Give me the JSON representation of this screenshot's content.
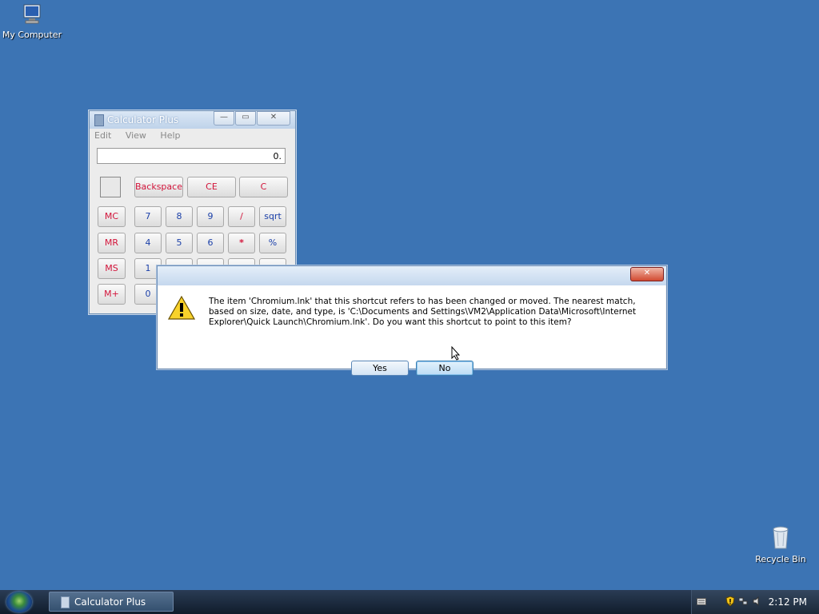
{
  "desktop": {
    "my_computer_label": "My Computer",
    "recycle_bin_label": "Recycle Bin"
  },
  "calculator": {
    "title": "Calculator Plus",
    "menu": [
      "Edit",
      "View",
      "Help"
    ],
    "display_value": "0.",
    "top_buttons": [
      "Backspace",
      "CE",
      "C"
    ],
    "memory_buttons": [
      "MC",
      "MR",
      "MS",
      "M+"
    ],
    "keypad": [
      [
        "7",
        "8",
        "9",
        "/",
        "sqrt"
      ],
      [
        "4",
        "5",
        "6",
        "*",
        "%"
      ],
      [
        "1"
      ],
      [
        "0"
      ]
    ]
  },
  "dialog": {
    "message": "The item 'Chromium.lnk' that this shortcut refers to has been changed or moved. The nearest match, based on size, date, and type, is 'C:\\Documents and Settings\\VM2\\Application Data\\Microsoft\\Internet Explorer\\Quick Launch\\Chromium.lnk'. Do you want this shortcut to point to this item?",
    "yes_label": "Yes",
    "no_label": "No",
    "icon": "warning-icon"
  },
  "taskbar": {
    "task_label": "Calculator Plus",
    "clock": "2:12 PM"
  },
  "colors": {
    "desktop": "#3c74b4",
    "calc_red": "#d2143a",
    "calc_blue": "#1a3fa8"
  }
}
